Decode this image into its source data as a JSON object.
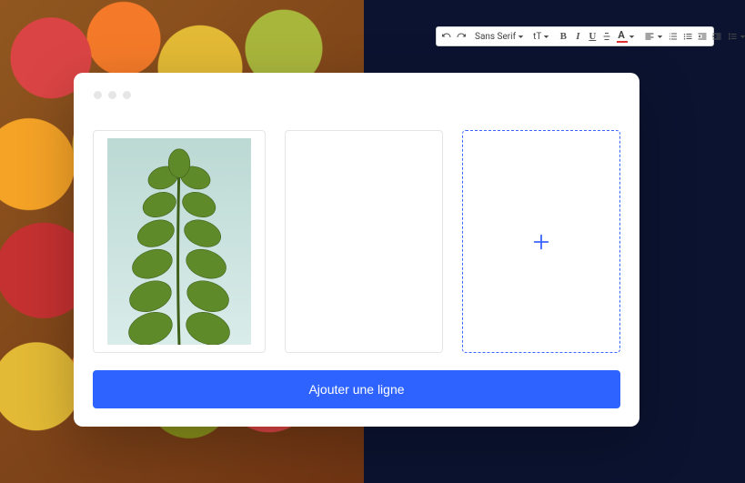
{
  "toolbar": {
    "font_family_label": "Sans Serif",
    "font_size_glyph": "tT",
    "bold_glyph": "B",
    "italic_glyph": "I",
    "underline_glyph": "U",
    "text_color_glyph": "A"
  },
  "editor": {
    "add_row_label": "Ajouter une ligne"
  },
  "colors": {
    "primary": "#2e63ff"
  }
}
